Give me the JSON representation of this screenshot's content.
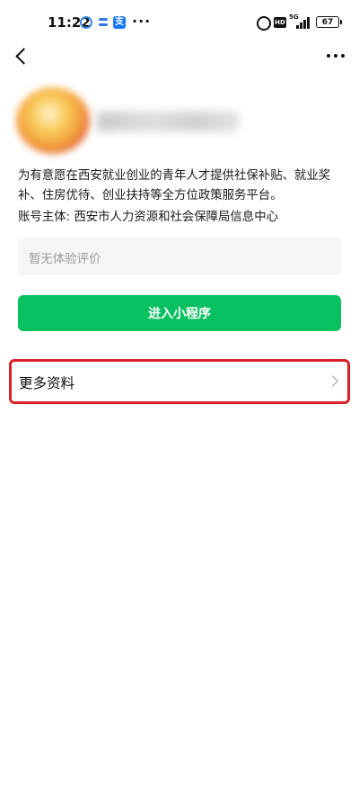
{
  "status_bar": {
    "time": "11:22",
    "app_icon_3": "支",
    "dots": "···",
    "hd": "HD",
    "network": "5G",
    "battery": "67"
  },
  "icons": {
    "back": "back-arrow-icon",
    "more": "more-dots-icon",
    "chevron": "chevron-right-icon",
    "alarm": "alarm-icon",
    "signal": "signal-icon",
    "battery": "battery-icon"
  },
  "profile": {
    "description": "为有意愿在西安就业创业的青年人才提供社保补贴、就业奖补、住房优待、创业扶持等全方位政策服务平台。",
    "account_subject": "账号主体: 西安市人力资源和社会保障局信息中心"
  },
  "review": {
    "empty_text": "暂无体验评价"
  },
  "actions": {
    "enter_label": "进入小程序"
  },
  "more_info": {
    "label": "更多资料"
  },
  "colors": {
    "primary_green": "#07c160",
    "highlight_red": "#d8232a",
    "review_bg": "#f6f6f6"
  }
}
